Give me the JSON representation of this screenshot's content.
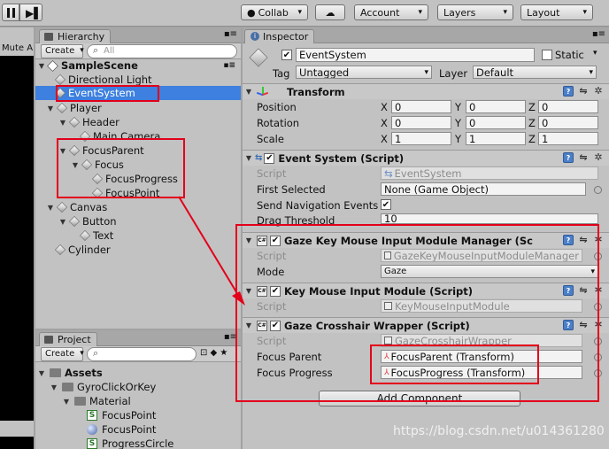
{
  "toolbar": {
    "collab": "Collab",
    "account": "Account",
    "layers": "Layers",
    "layout": "Layout"
  },
  "left_strip": {
    "mute": "Mute A"
  },
  "hierarchy": {
    "tab": "Hierarchy",
    "create": "Create",
    "search": "All",
    "scene": "SampleScene",
    "items": [
      "Directional Light",
      "EventSystem",
      "Player",
      "Header",
      "Main Camera",
      "FocusParent",
      "Focus",
      "FocusProgress",
      "FocusPoint",
      "Canvas",
      "Button",
      "Text",
      "Cylinder"
    ]
  },
  "project": {
    "tab": "Project",
    "create": "Create",
    "assets": "Assets",
    "folders": [
      "GyroClickOrKey",
      "Material"
    ],
    "files": [
      "FocusPoint",
      "FocusPoint",
      "ProgressCircle"
    ]
  },
  "inspector": {
    "tab": "Inspector",
    "name": "EventSystem",
    "static": "Static",
    "tag_label": "Tag",
    "tag": "Untagged",
    "layer_label": "Layer",
    "layer": "Default",
    "transform": {
      "title": "Transform",
      "position": "Position",
      "rotation": "Rotation",
      "scale": "Scale",
      "x": "X",
      "y": "Y",
      "z": "Z",
      "pos": [
        "0",
        "0",
        "0"
      ],
      "rot": [
        "0",
        "0",
        "0"
      ],
      "scl": [
        "1",
        "1",
        "1"
      ]
    },
    "event_system": {
      "title": "Event System (Script)",
      "script_label": "Script",
      "script": "EventSystem",
      "first_selected": "First Selected",
      "first_selected_value": "None (Game Object)",
      "send_nav": "Send Navigation Events",
      "drag": "Drag Threshold",
      "drag_value": "10"
    },
    "gaze_manager": {
      "title": "Gaze Key Mouse Input Module Manager (Sc",
      "script_label": "Script",
      "script": "GazeKeyMouseInputModuleManager",
      "mode_label": "Mode",
      "mode": "Gaze"
    },
    "key_mouse": {
      "title": "Key Mouse Input Module (Script)",
      "script_label": "Script",
      "script": "KeyMouseInputModule"
    },
    "gaze_crosshair": {
      "title": "Gaze Crosshair Wrapper (Script)",
      "script_label": "Script",
      "script": "GazeCrosshairWrapper",
      "focus_parent_label": "Focus Parent",
      "focus_parent": "FocusParent (Transform)",
      "focus_progress_label": "Focus Progress",
      "focus_progress": "FocusProgress (Transform)"
    },
    "add_component": "Add Component"
  },
  "watermark": "https://blog.csdn.net/u014361280",
  "colors": {
    "selection": "#3d80df",
    "annotation": "#e3001b"
  }
}
